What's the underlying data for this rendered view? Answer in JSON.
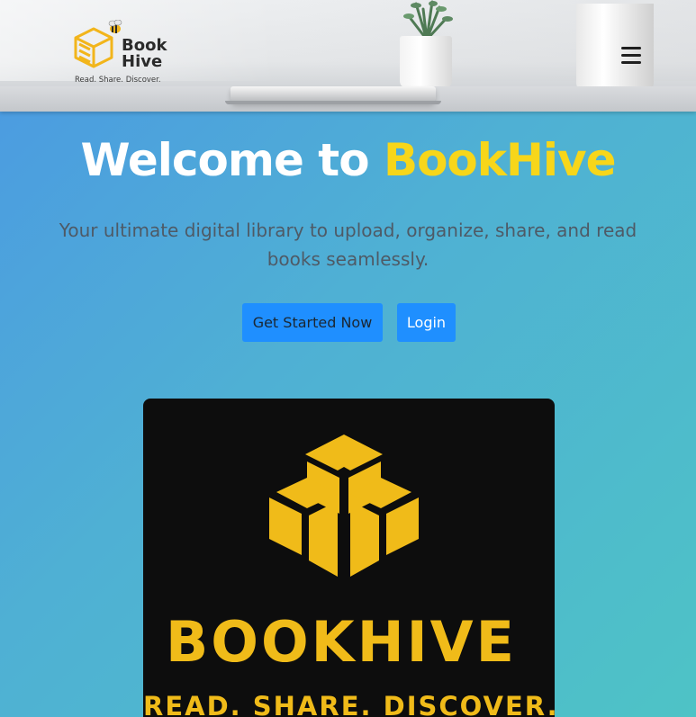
{
  "header": {
    "logo": {
      "name_line1": "Book",
      "name_line2": "Hive",
      "tagline": "Read. Share. Discover.",
      "icon": "book-cube-bee-icon"
    },
    "menu_icon": "hamburger-menu-icon"
  },
  "hero": {
    "title_prefix": "Welcome to ",
    "title_brand": "BookHive",
    "subtitle": "Your ultimate digital library to upload, organize, share, and read books seamlessly.",
    "get_started_label": "Get Started Now",
    "login_label": "Login"
  },
  "brand_card": {
    "icon": "book-cube-icon",
    "name": "BOOKHIVE",
    "tagline": "READ. SHARE. DISCOVER."
  },
  "colors": {
    "accent_yellow": "#f7d61a",
    "card_gold": "#f0bb19",
    "button_blue": "#1f8fff",
    "card_background": "#0d0d0d"
  }
}
